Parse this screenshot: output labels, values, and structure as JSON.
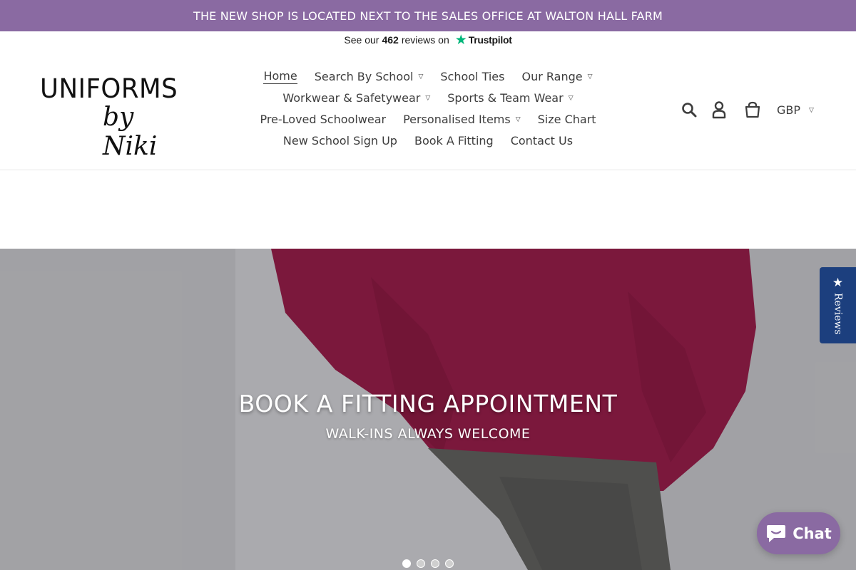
{
  "announcement": {
    "text": "THE NEW SHOP IS LOCATED NEXT TO THE SALES OFFICE AT WALTON HALL FARM",
    "background": "#8a6aa2"
  },
  "trustpilot": {
    "prefix": "See our",
    "count": "462",
    "middle": "reviews on",
    "brand": "Trustpilot",
    "star_icon": "star-icon",
    "star_color": "#00b67a"
  },
  "logo": {
    "line1": "UNIFORMS",
    "line2": "by Niki"
  },
  "nav": {
    "rows": [
      [
        {
          "label": "Home",
          "active": true,
          "dropdown": false
        },
        {
          "label": "Search By School",
          "dropdown": true
        },
        {
          "label": "School Ties",
          "dropdown": false
        },
        {
          "label": "Our Range",
          "dropdown": true
        }
      ],
      [
        {
          "label": "Workwear & Safetywear",
          "dropdown": true
        },
        {
          "label": "Sports & Team Wear",
          "dropdown": true
        }
      ],
      [
        {
          "label": "Pre-Loved Schoolwear",
          "dropdown": false
        },
        {
          "label": "Personalised Items",
          "dropdown": true
        },
        {
          "label": "Size Chart",
          "dropdown": false
        }
      ],
      [
        {
          "label": "New School Sign Up",
          "dropdown": false
        },
        {
          "label": "Book A Fitting",
          "dropdown": false
        },
        {
          "label": "Contact Us",
          "dropdown": false
        }
      ]
    ]
  },
  "tools": {
    "search_icon": "search-icon",
    "account_icon": "user-icon",
    "cart_icon": "cart-icon",
    "currency": "GBP"
  },
  "hero": {
    "title": "BOOK A FITTING APPOINTMENT",
    "subtitle": "WALK-INS ALWAYS WELCOME",
    "slides": 4,
    "active_slide": 0
  },
  "reviews_tab": {
    "label": "Reviews",
    "background": "#1c3f7e"
  },
  "chat": {
    "label": "Chat",
    "background": "#8a6aa2"
  }
}
